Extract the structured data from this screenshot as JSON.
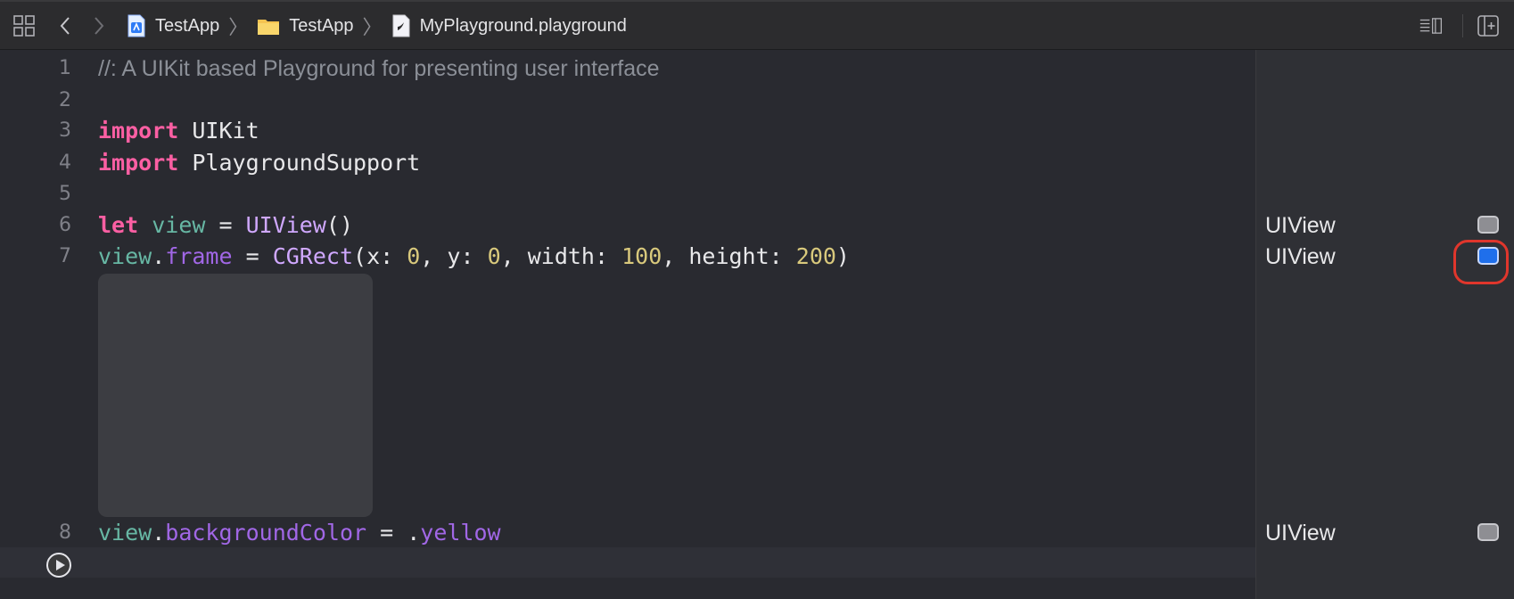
{
  "toolbar": {
    "breadcrumbs": [
      {
        "label": "TestApp",
        "icon": "xcode-project-icon"
      },
      {
        "label": "TestApp",
        "icon": "folder-icon"
      },
      {
        "label": "MyPlayground.playground",
        "icon": "playground-file-icon"
      }
    ],
    "separator": "〉"
  },
  "editor": {
    "lines": [
      {
        "number": "1",
        "tokens": [
          {
            "cls": "comment",
            "text": "//: A UIKit based Playground for presenting user interface"
          }
        ]
      },
      {
        "number": "2",
        "tokens": []
      },
      {
        "number": "3",
        "tokens": [
          {
            "cls": "kw",
            "text": "import"
          },
          {
            "cls": "plain",
            "text": " UIKit"
          }
        ]
      },
      {
        "number": "4",
        "tokens": [
          {
            "cls": "kw",
            "text": "import"
          },
          {
            "cls": "plain",
            "text": " PlaygroundSupport"
          }
        ]
      },
      {
        "number": "5",
        "tokens": []
      },
      {
        "number": "6",
        "tokens": [
          {
            "cls": "kw",
            "text": "let"
          },
          {
            "cls": "plain",
            "text": " "
          },
          {
            "cls": "var",
            "text": "view"
          },
          {
            "cls": "plain",
            "text": " = "
          },
          {
            "cls": "type",
            "text": "UIView"
          },
          {
            "cls": "plain",
            "text": "()"
          }
        ]
      },
      {
        "number": "7",
        "tokens": [
          {
            "cls": "var",
            "text": "view"
          },
          {
            "cls": "plain",
            "text": "."
          },
          {
            "cls": "prop",
            "text": "frame"
          },
          {
            "cls": "plain",
            "text": " = "
          },
          {
            "cls": "type",
            "text": "CGRect"
          },
          {
            "cls": "plain",
            "text": "(x: "
          },
          {
            "cls": "num",
            "text": "0"
          },
          {
            "cls": "plain",
            "text": ", y: "
          },
          {
            "cls": "num",
            "text": "0"
          },
          {
            "cls": "plain",
            "text": ", width: "
          },
          {
            "cls": "num",
            "text": "100"
          },
          {
            "cls": "plain",
            "text": ", height: "
          },
          {
            "cls": "num",
            "text": "200"
          },
          {
            "cls": "plain",
            "text": ")"
          }
        ]
      },
      {
        "number": "8",
        "tokens": [
          {
            "cls": "var",
            "text": "view"
          },
          {
            "cls": "plain",
            "text": "."
          },
          {
            "cls": "prop",
            "text": "backgroundColor"
          },
          {
            "cls": "plain",
            "text": " = ."
          },
          {
            "cls": "prop",
            "text": "yellow"
          }
        ]
      }
    ]
  },
  "results": {
    "rows": [
      {
        "label": "UIView",
        "active": false
      },
      {
        "label": "UIView",
        "active": true
      },
      {
        "label": "UIView",
        "active": false
      }
    ]
  },
  "colors": {
    "keyword": "#fc5fa3",
    "type": "#d0a8ff",
    "number": "#d9c97c",
    "property": "#a167e6",
    "variable": "#67b7a4",
    "highlight": "#e0362c"
  }
}
